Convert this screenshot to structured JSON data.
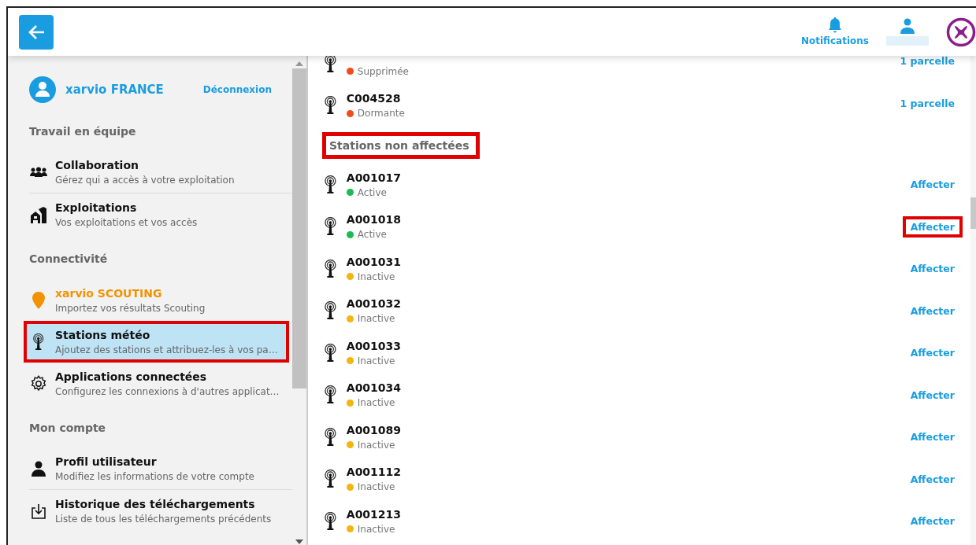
{
  "header": {
    "notifications_label": "Notifications"
  },
  "sidebar": {
    "account": {
      "name": "xarvio FRANCE",
      "logout": "Déconnexion"
    },
    "sections": [
      {
        "title": "Travail en équipe",
        "items": [
          {
            "kind": "team",
            "title": "Collaboration",
            "subtitle": "Gérez qui a accès à votre exploitation",
            "selected": false,
            "highlighted": false
          },
          {
            "kind": "farm",
            "title": "Exploitations",
            "subtitle": "Vos exploitations et vos accès",
            "selected": false,
            "highlighted": false
          }
        ]
      },
      {
        "title": "Connectivité",
        "items": [
          {
            "kind": "scouting",
            "title": "xarvio SCOUTING",
            "subtitle": "Importez vos résultats Scouting",
            "selected": false,
            "highlighted": false
          },
          {
            "kind": "station",
            "title": "Stations météo",
            "subtitle": "Ajoutez des stations et attribuez-les à vos pa…",
            "selected": true,
            "highlighted": true
          },
          {
            "kind": "apps",
            "title": "Applications connectées",
            "subtitle": "Configurez les connexions à d'autres applicat…",
            "selected": false,
            "highlighted": false
          }
        ]
      },
      {
        "title": "Mon compte",
        "items": [
          {
            "kind": "profile",
            "title": "Profil utilisateur",
            "subtitle": "Modifiez les informations de votre compte",
            "selected": false,
            "highlighted": false
          },
          {
            "kind": "download",
            "title": "Historique des téléchargements",
            "subtitle": "Liste de tous les téléchargements précédents",
            "selected": false,
            "highlighted": false
          }
        ]
      }
    ]
  },
  "main": {
    "groups": [
      {
        "rows": [
          {
            "status": "Supprimée",
            "color": "#f44b1c",
            "action": "1 parcelle",
            "highlighted": false
          },
          {
            "name": "C004528",
            "status": "Dormante",
            "color": "#f44b1c",
            "action": "1 parcelle",
            "highlighted": false
          }
        ]
      },
      {
        "title": "Stations non affectées",
        "title_highlighted": true,
        "rows": [
          {
            "name": "A001017",
            "status": "Active",
            "color": "#1db954",
            "action": "Affecter",
            "highlighted": false
          },
          {
            "name": "A001018",
            "status": "Active",
            "color": "#1db954",
            "action": "Affecter",
            "highlighted": true
          },
          {
            "name": "A001031",
            "status": "Inactive",
            "color": "#f5b50f",
            "action": "Affecter",
            "highlighted": false
          },
          {
            "name": "A001032",
            "status": "Inactive",
            "color": "#f5b50f",
            "action": "Affecter",
            "highlighted": false
          },
          {
            "name": "A001033",
            "status": "Inactive",
            "color": "#f5b50f",
            "action": "Affecter",
            "highlighted": false
          },
          {
            "name": "A001034",
            "status": "Inactive",
            "color": "#f5b50f",
            "action": "Affecter",
            "highlighted": false
          },
          {
            "name": "A001089",
            "status": "Inactive",
            "color": "#f5b50f",
            "action": "Affecter",
            "highlighted": false
          },
          {
            "name": "A001112",
            "status": "Inactive",
            "color": "#f5b50f",
            "action": "Affecter",
            "highlighted": false
          },
          {
            "name": "A001213",
            "status": "Inactive",
            "color": "#f5b50f",
            "action": "Affecter",
            "highlighted": false
          }
        ]
      }
    ]
  }
}
